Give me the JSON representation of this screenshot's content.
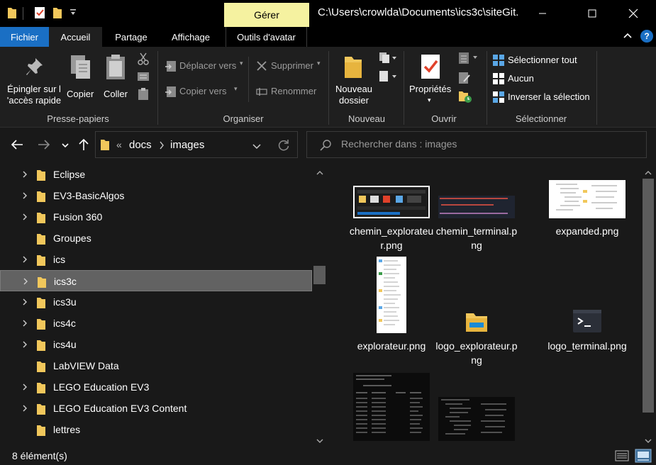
{
  "titlebar": {
    "context_tab": "Gérer",
    "path": "C:\\Users\\crowlda\\Documents\\ics3c\\siteGit..."
  },
  "tabs": {
    "file": "Fichier",
    "home": "Accueil",
    "share": "Partage",
    "view": "Affichage",
    "manage": "Outils d'avatar"
  },
  "ribbon": {
    "clipboard": {
      "pin_line1": "Épingler sur l",
      "pin_line2": "'accès rapide",
      "copy": "Copier",
      "paste": "Coller",
      "group": "Presse-papiers"
    },
    "organize": {
      "move_to": "Déplacer vers",
      "copy_to": "Copier vers",
      "delete": "Supprimer",
      "rename": "Renommer",
      "group": "Organiser"
    },
    "new": {
      "new_folder_line1": "Nouveau",
      "new_folder_line2": "dossier",
      "group": "Nouveau"
    },
    "open": {
      "properties": "Propriétés",
      "group": "Ouvrir"
    },
    "select": {
      "select_all": "Sélectionner tout",
      "none": "Aucun",
      "invert": "Inverser la sélection",
      "group": "Sélectionner"
    }
  },
  "address": {
    "overflow": "«",
    "crumbs": [
      "docs",
      "images"
    ]
  },
  "search": {
    "placeholder": "Rechercher dans : images"
  },
  "tree": {
    "items": [
      {
        "label": "Eclipse",
        "expandable": true
      },
      {
        "label": "EV3-BasicAlgos",
        "expandable": true
      },
      {
        "label": "Fusion 360",
        "expandable": true
      },
      {
        "label": "Groupes",
        "expandable": false
      },
      {
        "label": "ics",
        "expandable": true
      },
      {
        "label": "ics3c",
        "expandable": true,
        "selected": true
      },
      {
        "label": "ics3u",
        "expandable": true
      },
      {
        "label": "ics4c",
        "expandable": true
      },
      {
        "label": "ics4u",
        "expandable": true
      },
      {
        "label": "LabVIEW Data",
        "expandable": false
      },
      {
        "label": "LEGO Education EV3",
        "expandable": true
      },
      {
        "label": "LEGO Education EV3 Content",
        "expandable": true
      },
      {
        "label": "lettres",
        "expandable": false
      }
    ]
  },
  "files": [
    {
      "name": "chemin_explorateur.png",
      "thumb": "explorer-screenshot"
    },
    {
      "name": "chemin_terminal.png",
      "thumb": "terminal-screenshot"
    },
    {
      "name": "expanded.png",
      "thumb": "tree-screenshot"
    },
    {
      "name": "explorateur.png",
      "thumb": "sidebar-screenshot"
    },
    {
      "name": "logo_explorateur.png",
      "thumb": "explorer-logo"
    },
    {
      "name": "logo_terminal.png",
      "thumb": "terminal-logo"
    },
    {
      "name": "",
      "thumb": "dir-listing"
    },
    {
      "name": "",
      "thumb": "tree-listing"
    }
  ],
  "status": {
    "count": "8 élément(s)"
  },
  "colors": {
    "accent": "#1a6fc4",
    "folder": "#f1c75b",
    "context_tab": "#f5f2a0"
  }
}
